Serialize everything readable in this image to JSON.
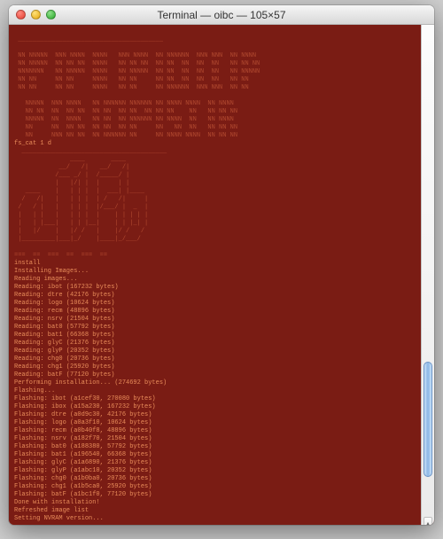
{
  "window": {
    "title": "Terminal — oibc — 105×57"
  },
  "term": {
    "banner_rows": [
      " _______________________________________",
      "",
      " NN NNNNN  NNN NNNN  NNNN   NNN NNNN  NN NNNNNN  NNN NNN  NN NNNN",
      " NN NNNNN  NN NN NN  NNNN   NN NN NN  NN NN  NN  NN  NN   NN NN NN",
      " NNNNNNN   NN NNNNN  NNNN   NN NNNNN  NN NN  NN  NN  NN   NN NNNNN",
      " NN NN     NN NN     NNNN   NN NN     NN NN  NN  NN  NN   NN NN",
      " NN NN     NN NN     NNNN   NN NN     NN NNNNNN  NNN NNN  NN NN",
      "",
      "   NNNNN  NNN NNNN   NN NNNNNN NNNNNN NN NNNN NNNN  NN NNNN",
      "   NN NN  NN  NN NN  NN NN  NN NN  NN NN NN    NN   NN NN NN",
      "   NNNNN  NN  NNNN   NN NN  NN NNNNNN NN NNNN  NN   NN NNNN",
      "   NN     NN  NN NN  NN NN  NN NN     NN   NN  NN   NN NN NN",
      "   NN     NNN NN NN  NN NNNNNN NN     NN NNNN NNNN  NN NN NN"
    ],
    "fs_cat": "fs_cat 1 d",
    "ascii_logo": [
      "  _______________________________________",
      "               ____       ____          ",
      "            __/   /|   __/   /|         ",
      "           /___ _/ |  /_____/ |         ",
      "           |   |/| |  |     | |         ",
      "   ____    |   | | |  |  ___| |____     ",
      "  /   /|   |   | | |  | /   /|     |    ",
      " /   / |   |   | | |  |/___/ |  _  |    ",
      " |   | |   |   | | |  |    | | | | |    ",
      " |   | |___|   | | |__|    | | |_| |    ",
      " |   |/    |   |/ /   |    |/ /   /     ",
      " |_________|___|_/    |____|_/___/      ",
      "                                        ",
      "===  ==  ===  ==  ===  ==               "
    ],
    "install_header": "install",
    "installing": "Installing Images...",
    "reading_images": "Reading images...",
    "reading": [
      "Reading: ibot (167232 bytes)",
      "Reading: dtre (42176 bytes)",
      "Reading: logo (10624 bytes)",
      "Reading: recm (48896 bytes)",
      "Reading: nsrv (21504 bytes)",
      "Reading: bat0 (57792 bytes)",
      "Reading: bat1 (66368 bytes)",
      "Reading: glyC (21376 bytes)",
      "Reading: glyP (20352 bytes)",
      "Reading: chg0 (20736 bytes)",
      "Reading: chg1 (25920 bytes)",
      "Reading: batF (77120 bytes)"
    ],
    "performing": "Performing installation... (274692 bytes)",
    "flashing_hdr": "Flashing...",
    "flashing": [
      "Flashing: ibot (a1cef30, 270080 bytes)",
      "Flashing: ibox (a15a230, 167232 bytes)",
      "Flashing: dtre (a0d9c30, 42176 bytes)",
      "Flashing: logo (a0a3f10, 10624 bytes)",
      "Flashing: recm (a0b40f8, 48896 bytes)",
      "Flashing: nsrv (a182f70, 21504 bytes)",
      "Flashing: bat0 (a188380, 57792 bytes)",
      "Flashing: bat1 (a196540, 66368 bytes)",
      "Flashing: glyC (a1a6890, 21376 bytes)",
      "Flashing: glyP (a1abc10, 20352 bytes)",
      "Flashing: chg0 (a1b0ba0, 20736 bytes)",
      "Flashing: chg1 (a1b5ca0, 25920 bytes)",
      "Flashing: batF (a1bc1f0, 77120 bytes)"
    ],
    "done": "Done with installation!",
    "refreshed": "Refreshed image list",
    "nvram": "Setting NVRAM version...",
    "cursor": "_"
  }
}
